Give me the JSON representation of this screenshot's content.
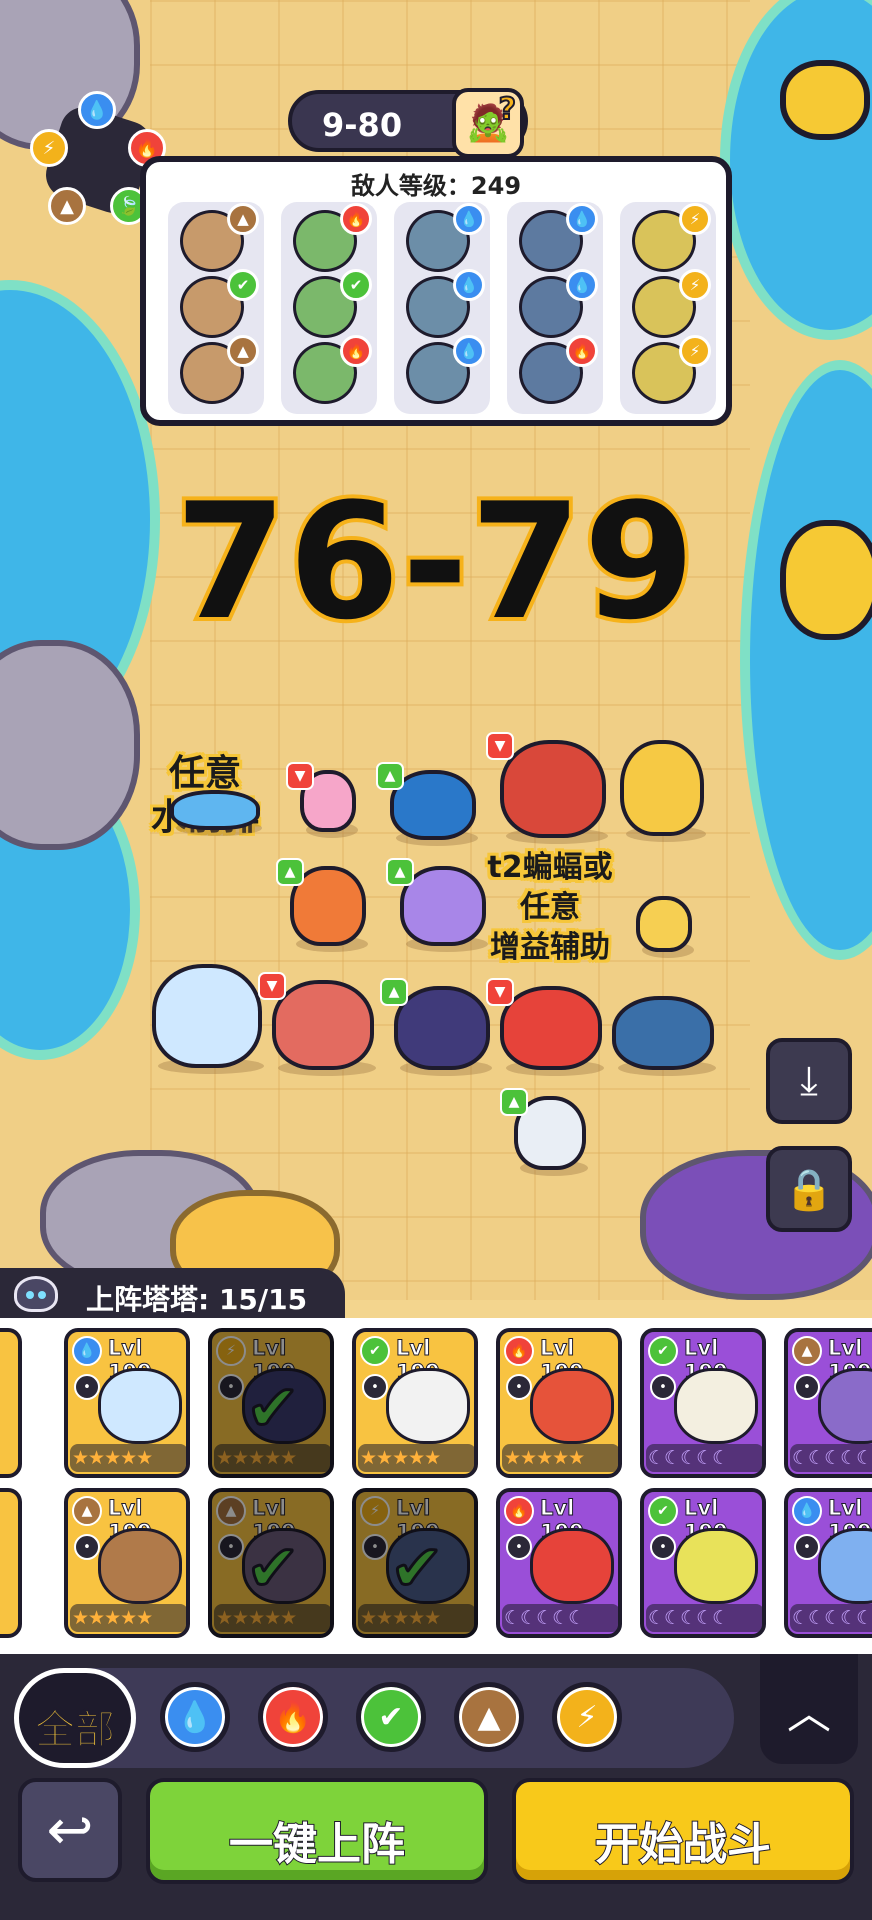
{
  "stage": {
    "label": "9-80",
    "boss_icon": "zombie-question-icon"
  },
  "element_colors": {
    "water": "#3a8ef0",
    "fire": "#f0433a",
    "grass": "#4cc23a",
    "earth": "#a8733f",
    "thunder": "#f3b21b"
  },
  "enemy_panel": {
    "title": "敌人等级：249",
    "columns": [
      {
        "elements": [
          "earth",
          "grass",
          "earth"
        ]
      },
      {
        "elements": [
          "fire",
          "grass",
          "fire"
        ]
      },
      {
        "elements": [
          "water",
          "water",
          "water"
        ]
      },
      {
        "elements": [
          "water",
          "water",
          "fire"
        ]
      },
      {
        "elements": [
          "thunder",
          "thunder",
          "thunder"
        ]
      }
    ]
  },
  "range_title": "76-79",
  "notes": {
    "front_row": "任意\n水前排",
    "support": "t2蝙蝠或\n任意\n增益辅助"
  },
  "roster": {
    "label": "上阵塔塔: 15/15"
  },
  "cards": {
    "row1": [
      {
        "element": "water",
        "level": "Lvl 199",
        "style": "gold",
        "selected": false,
        "stars": "★★★★★",
        "role": "hourglass-icon"
      },
      {
        "element": "thunder",
        "level": "Lvl 199",
        "style": "gold",
        "selected": true,
        "stars": "★★★★★",
        "role": "swirl-icon"
      },
      {
        "element": "grass",
        "level": "Lvl 199",
        "style": "gold",
        "selected": false,
        "stars": "★★★★★",
        "role": "fist-icon"
      },
      {
        "element": "fire",
        "level": "Lvl 199",
        "style": "gold",
        "selected": false,
        "stars": "★★★★★",
        "role": "swirl-icon"
      },
      {
        "element": "grass",
        "level": "Lvl 199",
        "style": "purple",
        "selected": false,
        "stars": "☾☾☾☾☾",
        "role": "plus-icon"
      },
      {
        "element": "earth",
        "level": "Lvl 199",
        "style": "purple",
        "selected": false,
        "stars": "☾☾☾☾☾",
        "role": "shield-icon"
      }
    ],
    "row2": [
      {
        "element": "earth",
        "level": "Lvl 199",
        "style": "gold",
        "selected": false,
        "stars": "★★★★★",
        "role": "boot-icon"
      },
      {
        "element": "earth",
        "level": "Lvl 199",
        "style": "gold",
        "selected": true,
        "stars": "★★★★★",
        "role": "boot-icon"
      },
      {
        "element": "thunder",
        "level": "Lvl 199",
        "style": "gold",
        "selected": true,
        "stars": "★★★★★",
        "role": "eye-icon"
      },
      {
        "element": "fire",
        "level": "Lvl 199",
        "style": "purple",
        "selected": false,
        "stars": "☾☾☾☾☾",
        "role": "boot-icon"
      },
      {
        "element": "grass",
        "level": "Lvl 199",
        "style": "purple",
        "selected": false,
        "stars": "☾☾☾☾☾",
        "role": "boot-icon"
      },
      {
        "element": "water",
        "level": "Lvl 199",
        "style": "purple",
        "selected": false,
        "stars": "☾☾☾☾☾",
        "role": "plus-icon"
      }
    ]
  },
  "filter": {
    "all_label": "全部",
    "elements": [
      "water",
      "fire",
      "grass",
      "earth",
      "thunder"
    ]
  },
  "buttons": {
    "auto_deploy": "一键上阵",
    "start_battle": "开始战斗"
  }
}
